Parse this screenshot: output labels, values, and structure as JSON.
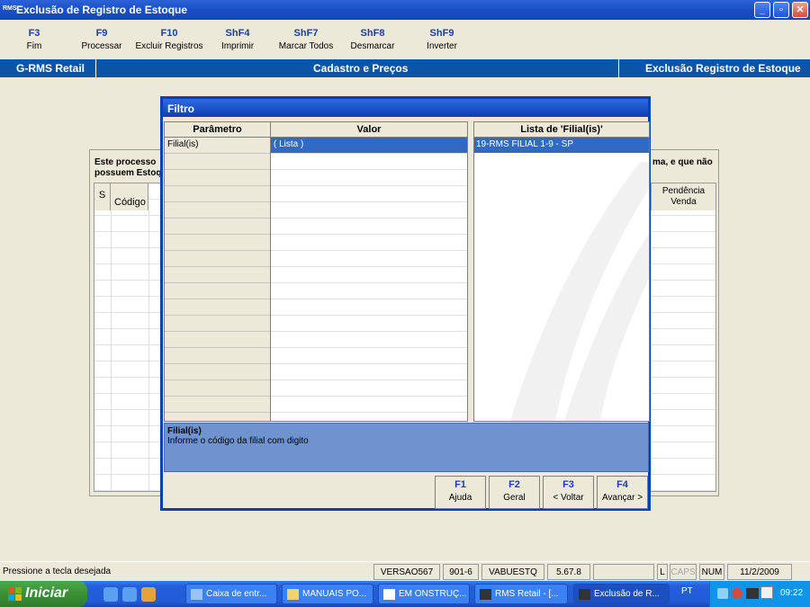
{
  "window": {
    "title": "Exclusão de Registro de Estoque",
    "app_icon_text": "RMS"
  },
  "window_controls": {
    "minimize": "_",
    "maximize": "▫",
    "close": "✕"
  },
  "fkeys": [
    {
      "key": "F3",
      "label": "Fim"
    },
    {
      "key": "F9",
      "label": "Processar"
    },
    {
      "key": "F10",
      "label": "Excluir Registros"
    },
    {
      "key": "ShF4",
      "label": "Imprimir"
    },
    {
      "key": "ShF7",
      "label": "Marcar Todos"
    },
    {
      "key": "ShF8",
      "label": "Desmarcar"
    },
    {
      "key": "ShF9",
      "label": "Inverter"
    }
  ],
  "header": {
    "left": "G-RMS Retail",
    "center": "Cadastro e Preços",
    "right": "Exclusão Registro de Estoque"
  },
  "background_panel": {
    "description_line1": "Este processo",
    "description_line2": "possuem Estoq",
    "description_right": "ma, e que não",
    "col_s": "S",
    "col_codigo": "Código",
    "col_pendencia": "Pendência Venda"
  },
  "dialog": {
    "title": "Filtro",
    "param_header": "Parâmetro",
    "value_header": "Valor",
    "rows": [
      {
        "param": "Filial(is)",
        "value": "( Lista )"
      }
    ],
    "list_header": "Lista de 'Filial(is)'",
    "list_items": [
      "19-RMS FILIAL 1-9 - SP"
    ],
    "hint_title": "Filial(is)",
    "hint_text": "Informe o código da filial com digito",
    "buttons": [
      {
        "key": "F1",
        "label": "Ajuda"
      },
      {
        "key": "F2",
        "label": "Geral"
      },
      {
        "key": "F3",
        "label": "< Voltar"
      },
      {
        "key": "F4",
        "label": "Avançar >"
      }
    ]
  },
  "statusbar": {
    "message": "Pressione a tecla desejada",
    "cells": [
      "VERSAO567",
      "901-6",
      "VABUESTQ",
      "5.67.8",
      "",
      "L",
      "CAPS",
      "NUM",
      "11/2/2009"
    ]
  },
  "taskbar": {
    "start_label": "Iniciar",
    "tasks": [
      "Caixa de entr...",
      "MANUAIS PO...",
      "EM ONSTRUÇ...",
      "RMS Retail - [...",
      "Exclusão de R..."
    ],
    "language": "PT",
    "clock": "09:22"
  },
  "colors": {
    "accent_blue": "#0B55A8",
    "selection": "#316AC5",
    "hint_bg": "#6E93CF"
  }
}
